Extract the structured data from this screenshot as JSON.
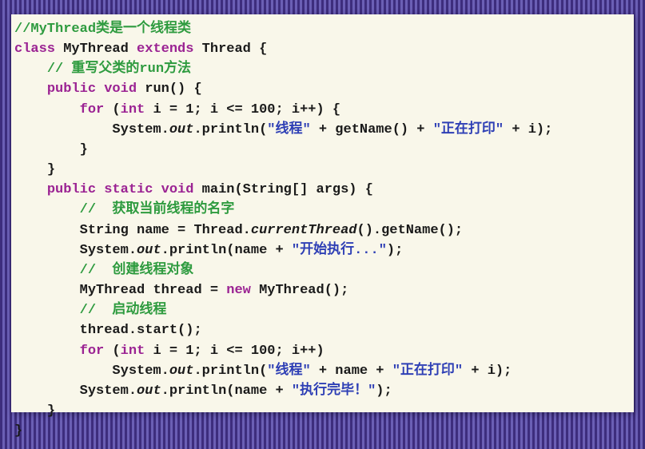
{
  "code": {
    "l1": {
      "comment": "//MyThread类是一个线程类"
    },
    "l2": {
      "kw1": "class",
      "p1": " MyThread ",
      "kw2": "extends",
      "p2": " Thread {"
    },
    "l3": {
      "indent": "    ",
      "comment": "// 重写父类的run方法"
    },
    "l4": {
      "indent": "    ",
      "kw1": "public",
      "sp1": " ",
      "kw2": "void",
      "p1": " run() {"
    },
    "l5": {
      "indent": "        ",
      "kw1": "for",
      "p1": " (",
      "kw2": "int",
      "p2": " i = 1; i <= 100; i++) {"
    },
    "l6": {
      "indent": "            ",
      "p1": "System.",
      "it1": "out",
      "p2": ".println(",
      "s1": "\"线程\"",
      "p3": " + getName() + ",
      "s2": "\"正在打印\"",
      "p4": " + i);"
    },
    "l7": {
      "indent": "        ",
      "p1": "}"
    },
    "l8": {
      "indent": "    ",
      "p1": "}"
    },
    "l9": {
      "indent": "    ",
      "kw1": "public",
      "sp1": " ",
      "kw2": "static",
      "sp2": " ",
      "kw3": "void",
      "p1": " main(String[] args) {"
    },
    "l10": {
      "indent": "        ",
      "comment": "//  获取当前线程的名字"
    },
    "l11": {
      "indent": "        ",
      "p1": "String name = Thread.",
      "it1": "currentThread",
      "p2": "().getName();"
    },
    "l12": {
      "indent": "        ",
      "p1": "System.",
      "it1": "out",
      "p2": ".println(name + ",
      "s1": "\"开始执行...\"",
      "p3": ");"
    },
    "l13": {
      "indent": "        ",
      "comment": "//  创建线程对象"
    },
    "l14": {
      "indent": "        ",
      "p1": "MyThread thread = ",
      "kw1": "new",
      "p2": " MyThread();"
    },
    "l15": {
      "indent": "        ",
      "comment": "//  启动线程"
    },
    "l16": {
      "indent": "        ",
      "p1": "thread.start();"
    },
    "l17": {
      "indent": "        ",
      "kw1": "for",
      "p1": " (",
      "kw2": "int",
      "p2": " i = 1; i <= 100; i++)"
    },
    "l18": {
      "indent": "            ",
      "p1": "System.",
      "it1": "out",
      "p2": ".println(",
      "s1": "\"线程\"",
      "p3": " + name + ",
      "s2": "\"正在打印\"",
      "p4": " + i);"
    },
    "l19": {
      "indent": "        ",
      "p1": "System.",
      "it1": "out",
      "p2": ".println(name + ",
      "s1": "\"执行完毕！\"",
      "p3": ");"
    },
    "l20": {
      "indent": "    ",
      "p1": "}"
    },
    "l21": {
      "p1": "}"
    }
  }
}
